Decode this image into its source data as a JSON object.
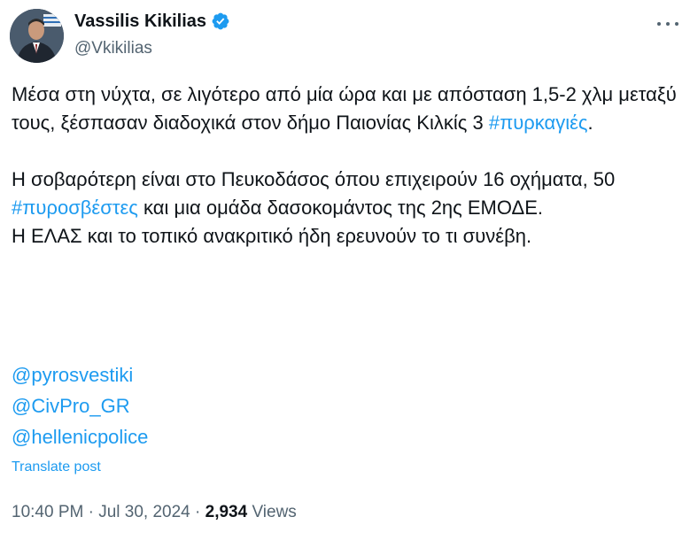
{
  "author": {
    "display_name": "Vassilis Kikilias",
    "handle": "@Vkikilias",
    "verified": true,
    "verified_color": "#1d9bf0"
  },
  "icons": {
    "more": "more-options-icon",
    "verified": "verified-badge-icon"
  },
  "tweet": {
    "paragraph1": {
      "text_before": "Μέσα στη νύχτα, σε λιγότερο από μία ώρα και με απόσταση 1,5-2 χλμ μεταξύ τους, ξέσπασαν διαδοχικά στον δήμο Παιονίας Κιλκίς 3 ",
      "hashtag": "#πυρκαγιές",
      "text_after": "."
    },
    "paragraph2": {
      "text_before": "Η σοβαρότερη είναι στο Πευκοδάσος όπου επιχειρούν 16 οχήματα, 50 ",
      "hashtag": "#πυροσβέστες",
      "text_after": " και μια ομάδα δασοκομάντος της 2ης ΕΜΟΔΕ."
    },
    "paragraph3": "Η ΕΛΑΣ και το τοπικό ανακριτικό ήδη ερευνούν το τι συνέβη.",
    "mentions": [
      "@pyrosvestiki",
      "@CivPro_GR",
      "@hellenicpolice"
    ],
    "translate_label": "Translate post"
  },
  "meta": {
    "time": "10:40 PM",
    "separator": "·",
    "date": "Jul 30, 2024",
    "views_count": "2,934",
    "views_label": "Views"
  },
  "colors": {
    "link": "#1d9bf0",
    "text": "#0f1419",
    "secondary": "#536471"
  }
}
